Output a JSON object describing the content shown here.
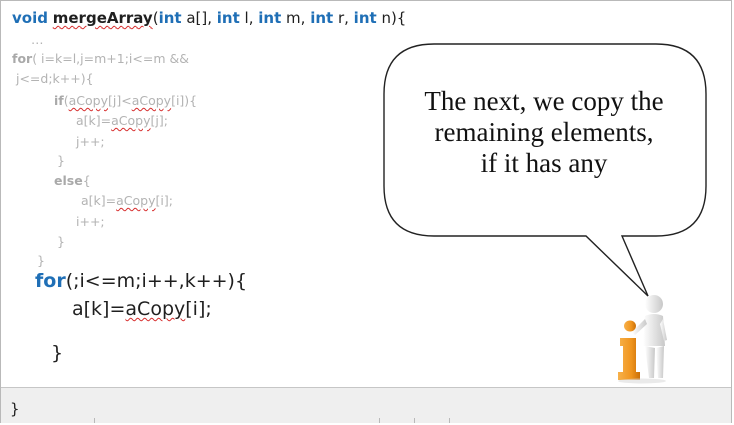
{
  "code": {
    "signature": {
      "kw_void": "void",
      "fn_name": "mergeArray",
      "paren_open": "(",
      "kw_int1": "int",
      "arg1": " a[], ",
      "kw_int2": "int",
      "arg2": " l, ",
      "kw_int3": "int",
      "arg3": " m, ",
      "kw_int4": "int",
      "arg4": " r, ",
      "kw_int5": "int",
      "arg5": " n){"
    },
    "ellipsis": "…",
    "faint_lines": {
      "for_kw": "for",
      "for_rest": "( i=k=l,j=m+1;i<=m &&",
      "for_cond2": " j<=d;k++){",
      "if_kw": "if",
      "if_open": "(",
      "if_copy1": "aCopy",
      "if_mid": "[j]<",
      "if_copy2": "aCopy",
      "if_end": "[i]){",
      "assign1_pre": "a[k]=",
      "assign1_copy": "aCopy",
      "assign1_post": "[j];",
      "incr_j": "j++;",
      "close_if": "}",
      "else_kw": "else",
      "else_open": "{",
      "assign2_pre": "a[k]=",
      "assign2_copy": "aCopy",
      "assign2_post": "[i];",
      "incr_i": "i++;",
      "close_else": "}",
      "close_for": "}"
    },
    "main_loop": {
      "for_kw": "for",
      "for_rest": "(;i<=m;i++,k++){",
      "assign_pre": "a[k]=",
      "assign_copy": "aCopy",
      "assign_post": "[i];",
      "close": "}"
    },
    "bottom_brace": "}"
  },
  "callout": {
    "line1": "The next, we copy the",
    "line2": "remaining elements,",
    "line3": "if it has any"
  },
  "colors": {
    "keyword": "#1f6fb6",
    "faint_code": "#b3b3b3",
    "squiggle": "#d62b2b",
    "info_orange": "#f0951e"
  },
  "icons": {
    "mascot": "info-person-icon"
  }
}
